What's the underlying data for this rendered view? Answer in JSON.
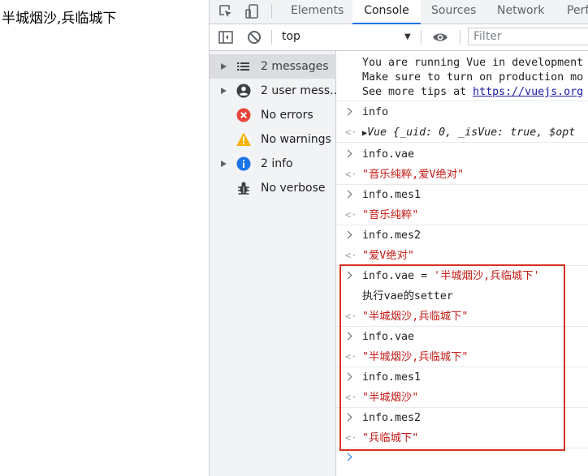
{
  "page": {
    "text": "半城烟沙,兵临城下"
  },
  "devtools": {
    "tabs": [
      "Elements",
      "Console",
      "Sources",
      "Network",
      "Perf"
    ],
    "active_tab": "Console",
    "toolbar": {
      "context": "top",
      "filter_placeholder": "Filter"
    },
    "sidebar": {
      "items": [
        {
          "label": "2 messages",
          "icon": "list-icon"
        },
        {
          "label": "2 user mess...",
          "icon": "user-icon"
        },
        {
          "label": "No errors",
          "icon": "error-icon"
        },
        {
          "label": "No warnings",
          "icon": "warning-icon"
        },
        {
          "label": "2 info",
          "icon": "info-icon"
        },
        {
          "label": "No verbose",
          "icon": "bug-icon"
        }
      ]
    },
    "console": {
      "intro": {
        "line1": "You are running Vue in development",
        "line2": "Make sure to turn on production mo",
        "line3_prefix": "See more tips at ",
        "line3_link": "https://vuejs.org"
      },
      "entries": {
        "in1": "info",
        "out1_a": "Vue {",
        "out1_b": "_uid: ",
        "out1_c": "0",
        "out1_d": ", _isVue: ",
        "out1_e": "true",
        "out1_f": ", $opt",
        "in2": "info.vae",
        "out2": "\"音乐纯粹,爱V绝对\"",
        "in3": "info.mes1",
        "out3": "\"音乐纯粹\"",
        "in4": "info.mes2",
        "out4": "\"爱V绝对\"",
        "in5_a": "info.vae ",
        "in5_b": "= ",
        "in5_c": "'半城烟沙,兵临城下'",
        "log5": "执行vae的setter",
        "out5": "\"半城烟沙,兵临城下\"",
        "in6": "info.vae",
        "out6": "\"半城烟沙,兵临城下\"",
        "in7": "info.mes1",
        "out7": "\"半城烟沙\"",
        "in8": "info.mes2",
        "out8": "\"兵临城下\""
      }
    }
  },
  "colors": {
    "highlight_border": "#d93025",
    "string": "#c41a16",
    "keyword": "#1a1aa6",
    "accent": "#1a73e8"
  }
}
